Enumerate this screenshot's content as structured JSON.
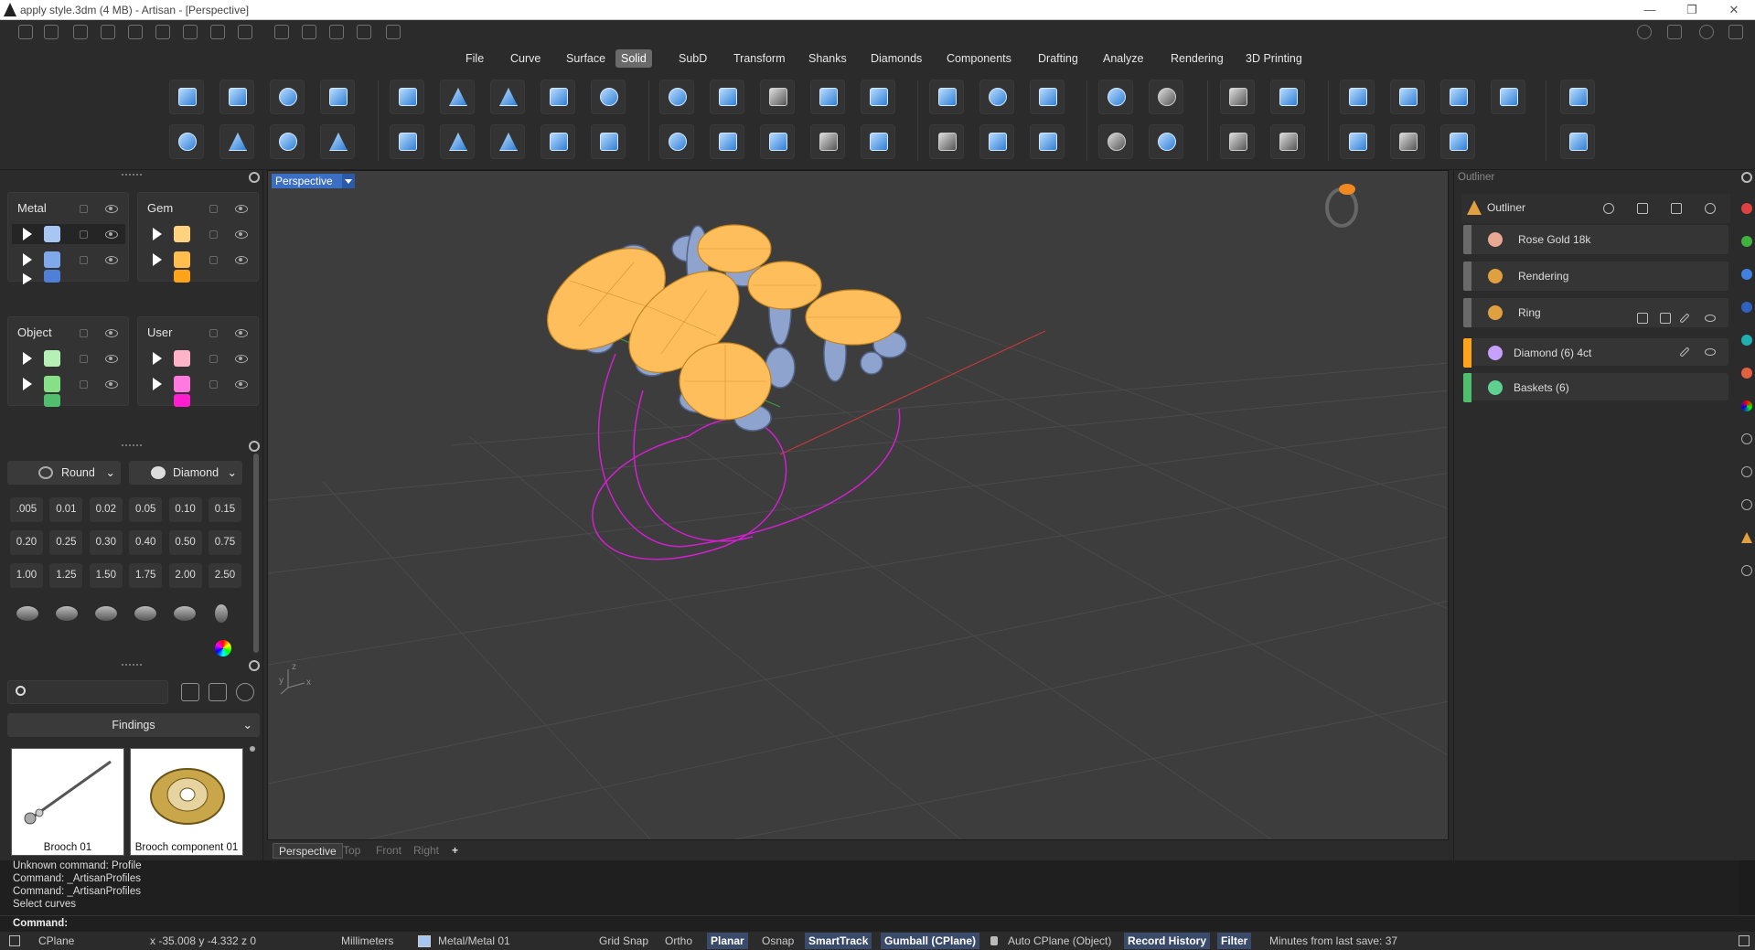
{
  "window": {
    "title": "apply style.3dm (4 MB) - Artisan - [Perspective]",
    "controls": [
      "—",
      "❐",
      "✕"
    ]
  },
  "menu": {
    "items": [
      "File",
      "Curve",
      "Surface",
      "Solid",
      "SubD",
      "Transform",
      "Shanks",
      "Diamonds",
      "Components",
      "Drafting",
      "Analyze",
      "Rendering",
      "3D Printing"
    ],
    "active": "Solid"
  },
  "layers": {
    "metal": {
      "title": "Metal",
      "colors": [
        "#a7c7f2",
        "#7fa9ea",
        "#4f7fd6"
      ]
    },
    "gem": {
      "title": "Gem",
      "colors": [
        "#ffd27f",
        "#ffbe4d",
        "#ffa41a"
      ]
    },
    "object": {
      "title": "Object",
      "colors": [
        "#b7f0b7",
        "#86e086",
        "#4fbf6f"
      ]
    },
    "user": {
      "title": "User",
      "colors": [
        "#ffb3c8",
        "#ff7ae0",
        "#ff1ecf"
      ]
    }
  },
  "gems": {
    "shape": "Round",
    "material": "Diamond",
    "sizes": [
      ".005",
      "0.01",
      "0.02",
      "0.05",
      "0.10",
      "0.15",
      "0.20",
      "0.25",
      "0.30",
      "0.40",
      "0.50",
      "0.75",
      "1.00",
      "1.25",
      "1.50",
      "1.75",
      "2.00",
      "2.50"
    ]
  },
  "library": {
    "search_placeholder": "",
    "category": "Findings",
    "items": [
      "Brooch 01",
      "Brooch component 01"
    ]
  },
  "viewport": {
    "label": "Perspective",
    "tabs": [
      "Perspective",
      "Top",
      "Front",
      "Right"
    ],
    "add_tab": "+"
  },
  "outliner": {
    "panel_title": "Outliner",
    "header": "Outliner",
    "rows": [
      {
        "label": "Rose Gold 18k",
        "bar": "#6a6a6a",
        "icon": "#e8a892"
      },
      {
        "label": "Rendering",
        "bar": "#6a6a6a",
        "icon": "#e0a040"
      },
      {
        "label": "Ring",
        "bar": "#6a6a6a",
        "icon": "#e0a040"
      },
      {
        "label": "Diamond (6) 4ct",
        "bar": "#ffa41a",
        "icon": "#c8a0ff"
      },
      {
        "label": "Baskets (6)",
        "bar": "#4fbf6f",
        "icon": "#5fd08f"
      }
    ]
  },
  "command": {
    "history": [
      "Unknown command: Profile",
      "Command: _ArtisanProfiles",
      "Command: _ArtisanProfiles",
      "Select curves"
    ],
    "prompt": "Command:"
  },
  "status": {
    "cplane": "CPlane",
    "coords": "x -35.008  y -4.332  z 0",
    "units": "Millimeters",
    "layer": "Metal/Metal 01",
    "grid_snap": "Grid Snap",
    "ortho": "Ortho",
    "planar": "Planar",
    "osnap": "Osnap",
    "smarttrack": "SmartTrack",
    "gumball": "Gumball (CPlane)",
    "auto_cplane": "Auto CPlane (Object)",
    "record_history": "Record History",
    "filter": "Filter",
    "last_save": "Minutes from last save: 37"
  },
  "colors": {
    "accent": "#3b6fc3",
    "gem_orange": "#ffbe5c",
    "metal_blue": "#9fb5e0",
    "curve_magenta": "#d020d0"
  }
}
